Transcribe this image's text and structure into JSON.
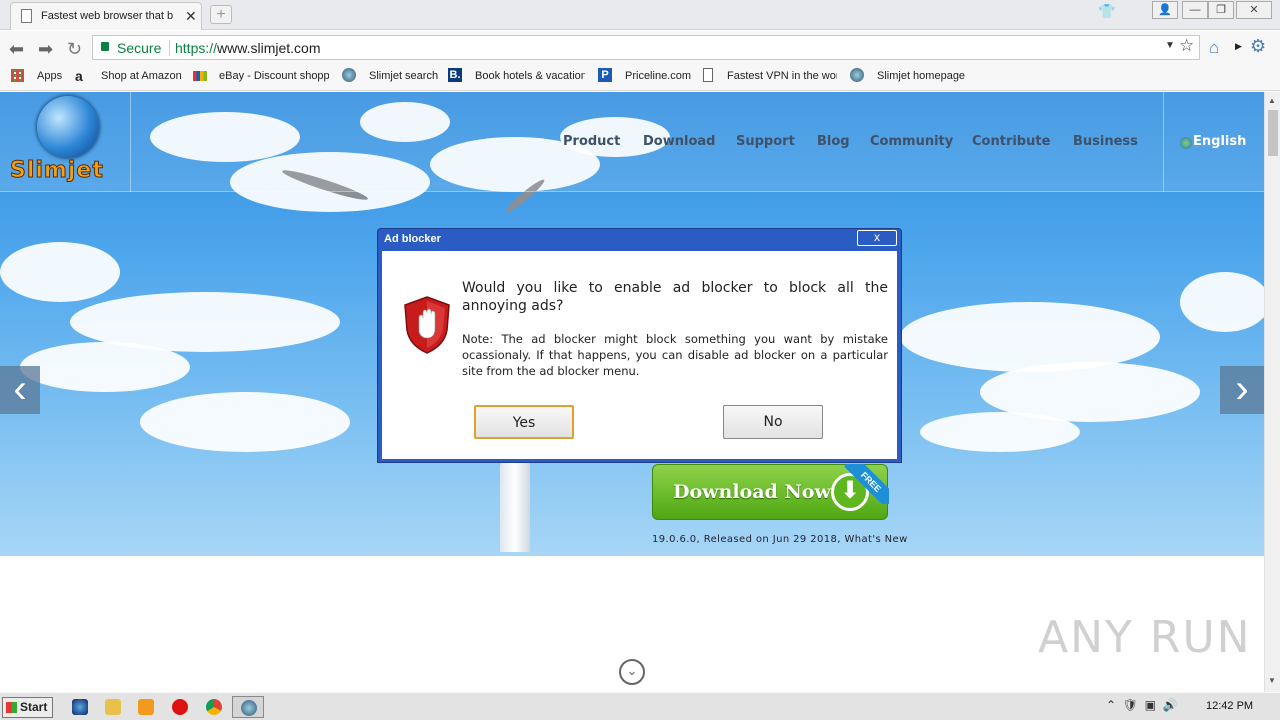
{
  "browser": {
    "tab_title": "Fastest web browser that b",
    "secure_label": "Secure",
    "url_scheme": "https://",
    "url_host": "www.slimjet.com"
  },
  "bookmarks": [
    {
      "label": "Apps",
      "icon": "apps-grid-icon"
    },
    {
      "label": "Shop at Amazon",
      "icon": "amazon-icon"
    },
    {
      "label": "eBay - Discount shoppi",
      "icon": "ebay-icon"
    },
    {
      "label": "Slimjet search",
      "icon": "globe-icon"
    },
    {
      "label": "Book hotels & vacation",
      "icon": "booking-icon"
    },
    {
      "label": "Priceline.com",
      "icon": "priceline-icon"
    },
    {
      "label": "Fastest VPN in the wor",
      "icon": "page-icon"
    },
    {
      "label": "Slimjet homepage",
      "icon": "globe-icon"
    }
  ],
  "site": {
    "logo_text": "Slimjet",
    "nav": [
      "Product",
      "Download",
      "Support",
      "Blog",
      "Community",
      "Contribute",
      "Business"
    ],
    "language": "English",
    "download_label": "Download Now",
    "free_badge": "FREE",
    "release_text": "19.0.6.0, Released on Jun 29 2018, What's New"
  },
  "dialog": {
    "title": "Ad blocker",
    "close_label": "x",
    "question": "Would you like to enable ad blocker to block all the annoying ads?",
    "note": "Note: The ad blocker might block something you want by mistake ocassionaly. If that happens, you can disable ad blocker on a particular site from the ad blocker menu.",
    "yes_label": "Yes",
    "no_label": "No"
  },
  "watermark": "ANY RUN",
  "taskbar": {
    "start_label": "Start",
    "clock": "12:42 PM"
  },
  "colors": {
    "secure_green": "#0b8043",
    "dialog_title_blue": "#2a5cc4",
    "download_green": "#4ea712",
    "logo_orange": "#f3a01a"
  }
}
